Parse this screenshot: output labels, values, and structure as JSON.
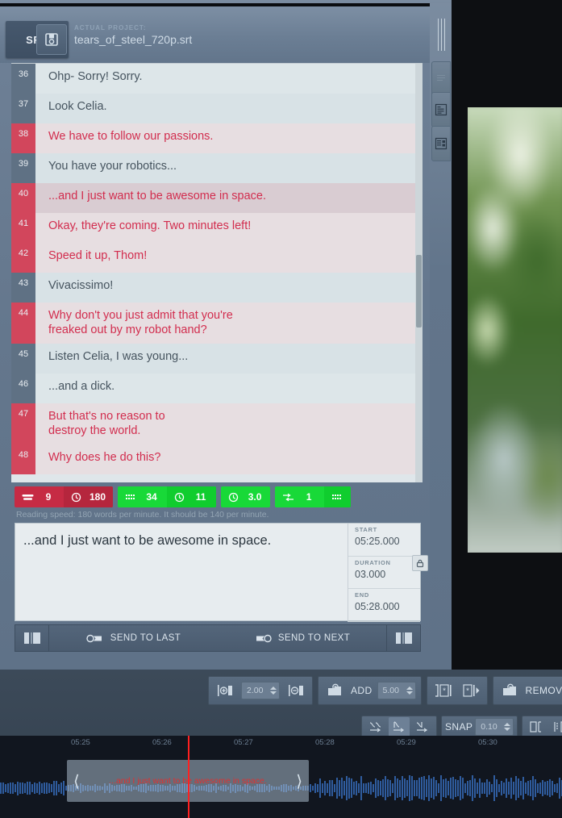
{
  "header": {
    "format_badge": "SRT",
    "save_icon": "save-disk-icon",
    "project_label": "ACTUAL PROJECT:",
    "project_name": "tears_of_steel_720p.srt"
  },
  "subtitle_list": {
    "rows": [
      {
        "num": "36",
        "text": "Ohp- Sorry! Sorry.",
        "status": "ok",
        "selected": false
      },
      {
        "num": "37",
        "text": "Look Celia.",
        "status": "ok",
        "selected": false
      },
      {
        "num": "38",
        "text": "We have to follow our passions.",
        "status": "bad",
        "selected": false
      },
      {
        "num": "39",
        "text": "You have your robotics...",
        "status": "ok",
        "selected": false
      },
      {
        "num": "40",
        "text": "...and I just want to be awesome in space.",
        "status": "bad",
        "selected": true
      },
      {
        "num": "41",
        "text": "Okay, they're coming. Two minutes left!",
        "status": "bad",
        "selected": false
      },
      {
        "num": "42",
        "text": "Speed it up, Thom!",
        "status": "bad",
        "selected": false
      },
      {
        "num": "43",
        "text": "Vivacissimo!",
        "status": "ok",
        "selected": false
      },
      {
        "num": "44",
        "text": "Why don't you just admit that you're\nfreaked out by my robot hand?",
        "status": "bad",
        "selected": false
      },
      {
        "num": "45",
        "text": "Listen Celia, I was young...",
        "status": "ok",
        "selected": false
      },
      {
        "num": "46",
        "text": "...and a dick.",
        "status": "ok",
        "selected": false
      },
      {
        "num": "47",
        "text": "But that's no reason to\ndestroy the world.",
        "status": "bad",
        "selected": false
      },
      {
        "num": "48",
        "text": "Why does he do this?",
        "status": "bad",
        "selected": false
      }
    ]
  },
  "stats": {
    "badges": [
      {
        "color": "red",
        "icon": "lines-icon",
        "value": "9",
        "icon2": "clock-wpm-icon",
        "value2": "180"
      },
      {
        "color": "green",
        "icon": "characters-icon",
        "value": "34",
        "icon2": "clock-icon",
        "value2": "11"
      },
      {
        "color": "green",
        "icon": "duration-clock-icon",
        "value": "3.0"
      },
      {
        "color": "green",
        "icon": "gap-arrows-icon",
        "value": "1",
        "icon2": "cps-grid-icon"
      }
    ],
    "note": "Reading speed: 180 words per minute. It should be 140 per minute."
  },
  "editor": {
    "text": "...and I just want to be awesome in space.",
    "lock_icon": "lock-icon",
    "fields": [
      {
        "label": "START",
        "value": "05:25.000"
      },
      {
        "label": "DURATION",
        "value": "03.000"
      },
      {
        "label": "END",
        "value": "05:28.000"
      }
    ]
  },
  "send_bar": {
    "left_icon": "split-panel-left-icon",
    "send_to_last": "SEND TO LAST",
    "send_to_last_icon": "send-left-icon",
    "send_to_next": "SEND TO NEXT",
    "send_to_next_icon": "send-right-icon",
    "right_icon": "split-panel-right-icon",
    "zoom_icon": "zoom-subtitle-icon"
  },
  "side_tabs": {
    "drag_handle": "drag-handle-icon",
    "items": [
      {
        "icon": "blank-panel-icon"
      },
      {
        "icon": "document-list-icon"
      },
      {
        "icon": "document-grid-icon"
      }
    ]
  },
  "toolbar": {
    "shift_left_icon": "shift-start-icon",
    "shift_value": "2.00",
    "shift_right_icon": "shift-end-icon",
    "add_icon": "add-box-icon",
    "add_label": "ADD",
    "add_value": "5.00",
    "split_left_icon": "split-before-icon",
    "split_right_icon": "split-after-icon",
    "remove_icon": "remove-box-icon",
    "remove_label": "REMOVE",
    "panel_icon": "panel-toggle-icon"
  },
  "toolbar2": {
    "buttons": [
      {
        "icon": "snap-prev-icon"
      },
      {
        "icon": "snap-mid-icon"
      },
      {
        "icon": "snap-next-icon"
      }
    ],
    "snap_label": "SNAP",
    "snap_value": "0.10",
    "align_icons": [
      {
        "icon": "align-left-icon"
      },
      {
        "icon": "align-right-icon"
      }
    ]
  },
  "timeline": {
    "ticks": [
      "05:25",
      "05:26",
      "05:27",
      "05:28",
      "05:29",
      "05:30"
    ],
    "block_text": "...and I just want to be awesome in space.",
    "left_handle": "resize-left-handle",
    "right_handle": "resize-right-handle",
    "playhead": "playhead-marker"
  },
  "colors": {
    "error_red": "#d2465c",
    "ok_green": "#18d938",
    "panel_blue": "#62758b",
    "playhead_red": "#ff2020"
  }
}
